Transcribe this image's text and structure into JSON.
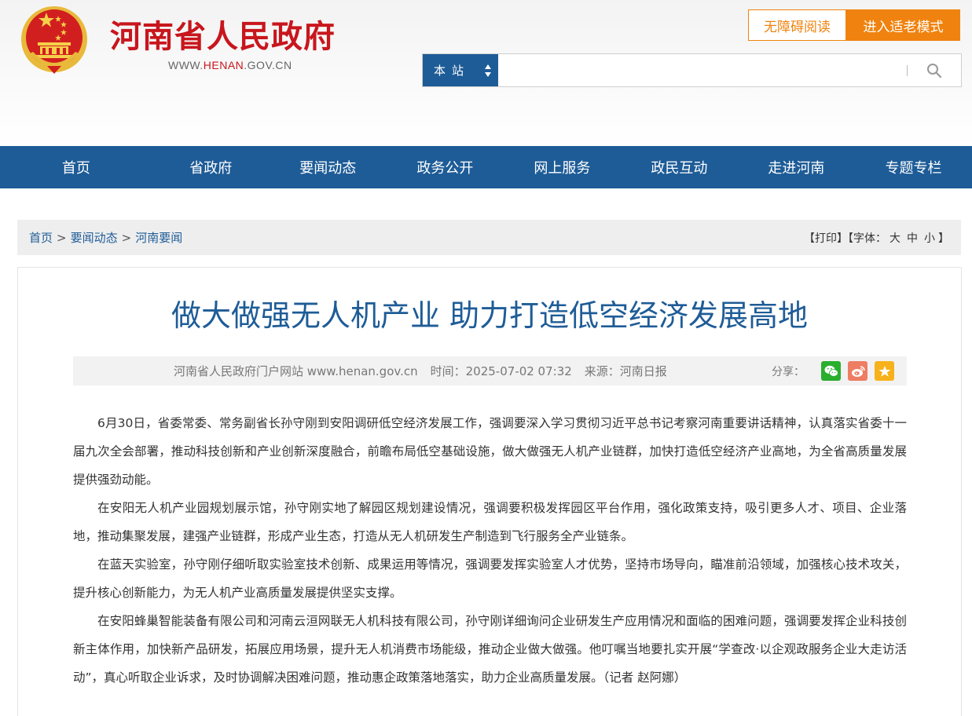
{
  "header": {
    "site_name": "河南省人民政府",
    "url_prefix": "WWW.",
    "url_highlight": "HENAN",
    "url_suffix": ".GOV.CN",
    "access_btn": "无障碍阅读",
    "elder_btn": "进入适老模式",
    "search_scope": "本站",
    "search_value": "",
    "search_icon": "search-icon",
    "accent": "#c8161d",
    "orange": "#f0830f",
    "blue": "#1e5c97"
  },
  "nav": {
    "items": [
      "首页",
      "省政府",
      "要闻动态",
      "政务公开",
      "网上服务",
      "政民互动",
      "走进河南",
      "专题专栏"
    ]
  },
  "breadcrumb": {
    "items": [
      "首页",
      "要闻动态",
      "河南要闻"
    ],
    "sep": ">",
    "print": "打印",
    "font_label": "字体：",
    "sizes": [
      "大",
      "中",
      "小"
    ]
  },
  "article": {
    "title": "做大做强无人机产业 助力打造低空经济发展高地",
    "site": "河南省人民政府门户网站 www.henan.gov.cn",
    "time": "时间：2025-07-02 07:32",
    "source": "来源：河南日报",
    "share_label": "分享：",
    "share_icons": [
      "wechat-icon",
      "weibo-icon",
      "favorite-icon"
    ],
    "paragraphs": [
      "6月30日，省委常委、常务副省长孙守刚到安阳调研低空经济发展工作，强调要深入学习贯彻习近平总书记考察河南重要讲话精神，认真落实省委十一届九次全会部署，推动科技创新和产业创新深度融合，前瞻布局低空基础设施，做大做强无人机产业链群，加快打造低空经济产业高地，为全省高质量发展提供强劲动能。",
      "在安阳无人机产业园规划展示馆，孙守刚实地了解园区规划建设情况，强调要积极发挥园区平台作用，强化政策支持，吸引更多人才、项目、企业落地，推动集聚发展，建强产业链群，形成产业生态，打造从无人机研发生产制造到飞行服务全产业链条。",
      "在蓝天实验室，孙守刚仔细听取实验室技术创新、成果运用等情况，强调要发挥实验室人才优势，坚持市场导向，瞄准前沿领域，加强核心技术攻关，提升核心创新能力，为无人机产业高质量发展提供坚实支撑。",
      "在安阳蜂巢智能装备有限公司和河南云洹网联无人机科技有限公司，孙守刚详细询问企业研发生产应用情况和面临的困难问题，强调要发挥企业科技创新主体作用，加快新产品研发，拓展应用场景，提升无人机消费市场能级，推动企业做大做强。他叮嘱当地要扎实开展“学查改·以企观政服务企业大走访活动”，真心听取企业诉求，及时协调解决困难问题，推动惠企政策落地落实，助力企业高质量发展。（记者 赵阿娜）"
    ]
  }
}
